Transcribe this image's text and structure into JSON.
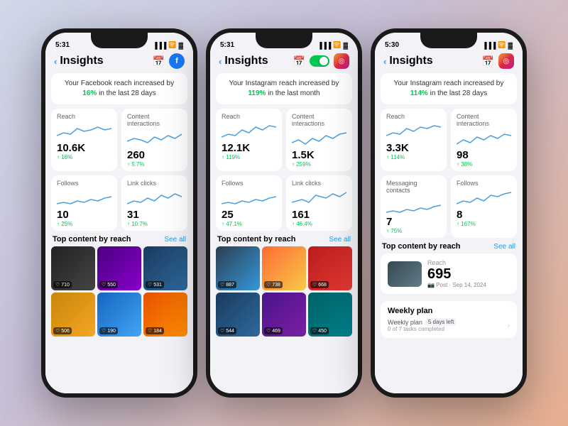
{
  "background": "linear-gradient(135deg, #d0d8e8 0%, #c8c0d8 40%, #e8b090 100%)",
  "phones": [
    {
      "id": "facebook-phone",
      "time": "5:31",
      "platform": "facebook",
      "title": "Insights",
      "headline": "Your Facebook reach increased by 16% in the last 28 days",
      "headline_pct": "16%",
      "stats": [
        {
          "label": "Reach",
          "value": "10.6K",
          "change": "↑ 16%",
          "chart_type": "wave"
        },
        {
          "label": "Content interactions",
          "value": "260",
          "change": "↑ 5.7%",
          "chart_type": "wave2"
        },
        {
          "label": "Follows",
          "value": "10",
          "change": "↑ 25%",
          "chart_type": "flat"
        },
        {
          "label": "Link clicks",
          "value": "31",
          "change": "↑ 10.7%",
          "chart_type": "wave3"
        }
      ],
      "section_title": "Top content by reach",
      "see_all": "See all",
      "thumbs": [
        "dark",
        "purple",
        "city",
        "gaming",
        "beer",
        "blue"
      ]
    },
    {
      "id": "instagram-phone-1",
      "time": "5:31",
      "platform": "instagram",
      "title": "Insights",
      "headline": "Your Instagram reach increased by 119% in the last month",
      "headline_pct": "119%",
      "stats": [
        {
          "label": "Reach",
          "value": "12.1K",
          "change": "↑ 119%",
          "chart_type": "wave"
        },
        {
          "label": "Content interactions",
          "value": "1.5K",
          "change": "↑ 259%",
          "chart_type": "wave2"
        },
        {
          "label": "Follows",
          "value": "25",
          "change": "↑ 47.1%",
          "chart_type": "flat"
        },
        {
          "label": "Link clicks",
          "value": "161",
          "change": "↑ 46.4%",
          "chart_type": "wave3"
        }
      ],
      "section_title": "Top content by reach",
      "see_all": "See all",
      "thumbs": [
        "heyday",
        "fire",
        "performer",
        "crowd",
        "concert",
        "festival",
        "marina"
      ]
    },
    {
      "id": "instagram-phone-2",
      "time": "5:30",
      "platform": "instagram",
      "title": "Insights",
      "headline": "Your Instagram reach increased by 114% in the last 28 days",
      "headline_pct": "114%",
      "stats": [
        {
          "label": "Reach",
          "value": "3.3K",
          "change": "↑ 114%",
          "chart_type": "wave"
        },
        {
          "label": "Content interactions",
          "value": "98",
          "change": "↑ 38%",
          "chart_type": "wave2"
        },
        {
          "label": "Messaging contacts",
          "value": "7",
          "change": "↑ 75%",
          "chart_type": "flat"
        },
        {
          "label": "Follows",
          "value": "8",
          "change": "↑ 167%",
          "chart_type": "wave3"
        }
      ],
      "section_title": "Top content by reach",
      "see_all": "See all",
      "post_reach": {
        "value": "695",
        "label": "Reach",
        "platform_label": "📷 Post · Sep 14, 2024"
      },
      "weekly_plan_title": "Weekly plan",
      "weekly_plan_label": "Weekly plan",
      "weekly_plan_days": "5 days left",
      "weekly_plan_sub": "0 of 7 tasks completed"
    }
  ]
}
